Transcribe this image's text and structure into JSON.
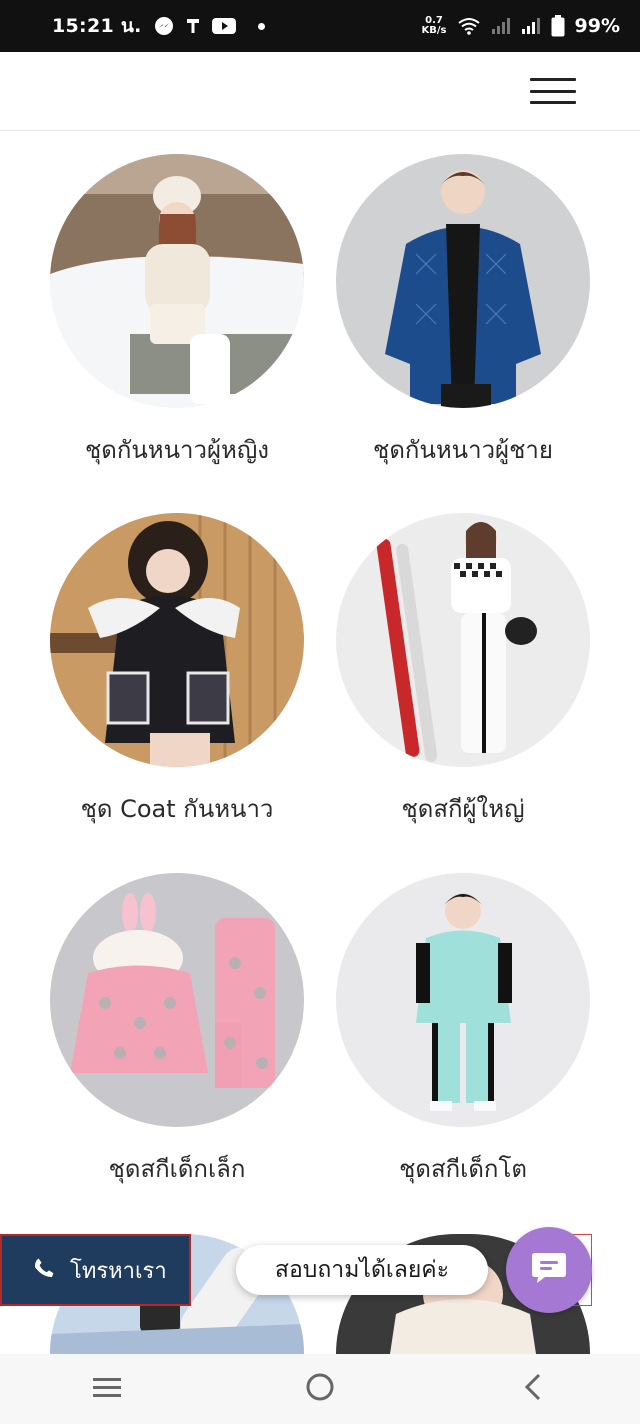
{
  "status_bar": {
    "time": "15:21 น.",
    "net_speed_value": "0.7",
    "net_speed_unit": "KB/s",
    "battery": "99%",
    "icons": [
      "messenger-icon",
      "usb-icon",
      "youtube-icon",
      "dot-icon",
      "wifi-icon",
      "signal-icon",
      "signal-icon",
      "battery-icon"
    ]
  },
  "header": {
    "menu_icon": "hamburger-icon"
  },
  "categories": [
    {
      "label": "ชุดกันหนาวผู้หญิง"
    },
    {
      "label": "ชุดกันหนาวผู้ชาย"
    },
    {
      "label": "ชุด Coat กันหนาว"
    },
    {
      "label": "ชุดสกีผู้ใหญ่"
    },
    {
      "label": "ชุดสกีเด็กเล็ก"
    },
    {
      "label": "ชุดสกีเด็กโต"
    }
  ],
  "call_button": {
    "label": "โทรหาเรา",
    "icon": "phone-icon"
  },
  "chat": {
    "prompt": "สอบถามได้เลยค่ะ",
    "icon": "chat-icon"
  },
  "nav_bar": {
    "icons": [
      "recent-apps-icon",
      "home-icon",
      "back-icon"
    ]
  },
  "colors": {
    "call_button_bg": "#1f3b5e",
    "chat_button_bg": "#a579d3",
    "status_bar_bg": "#111111"
  }
}
